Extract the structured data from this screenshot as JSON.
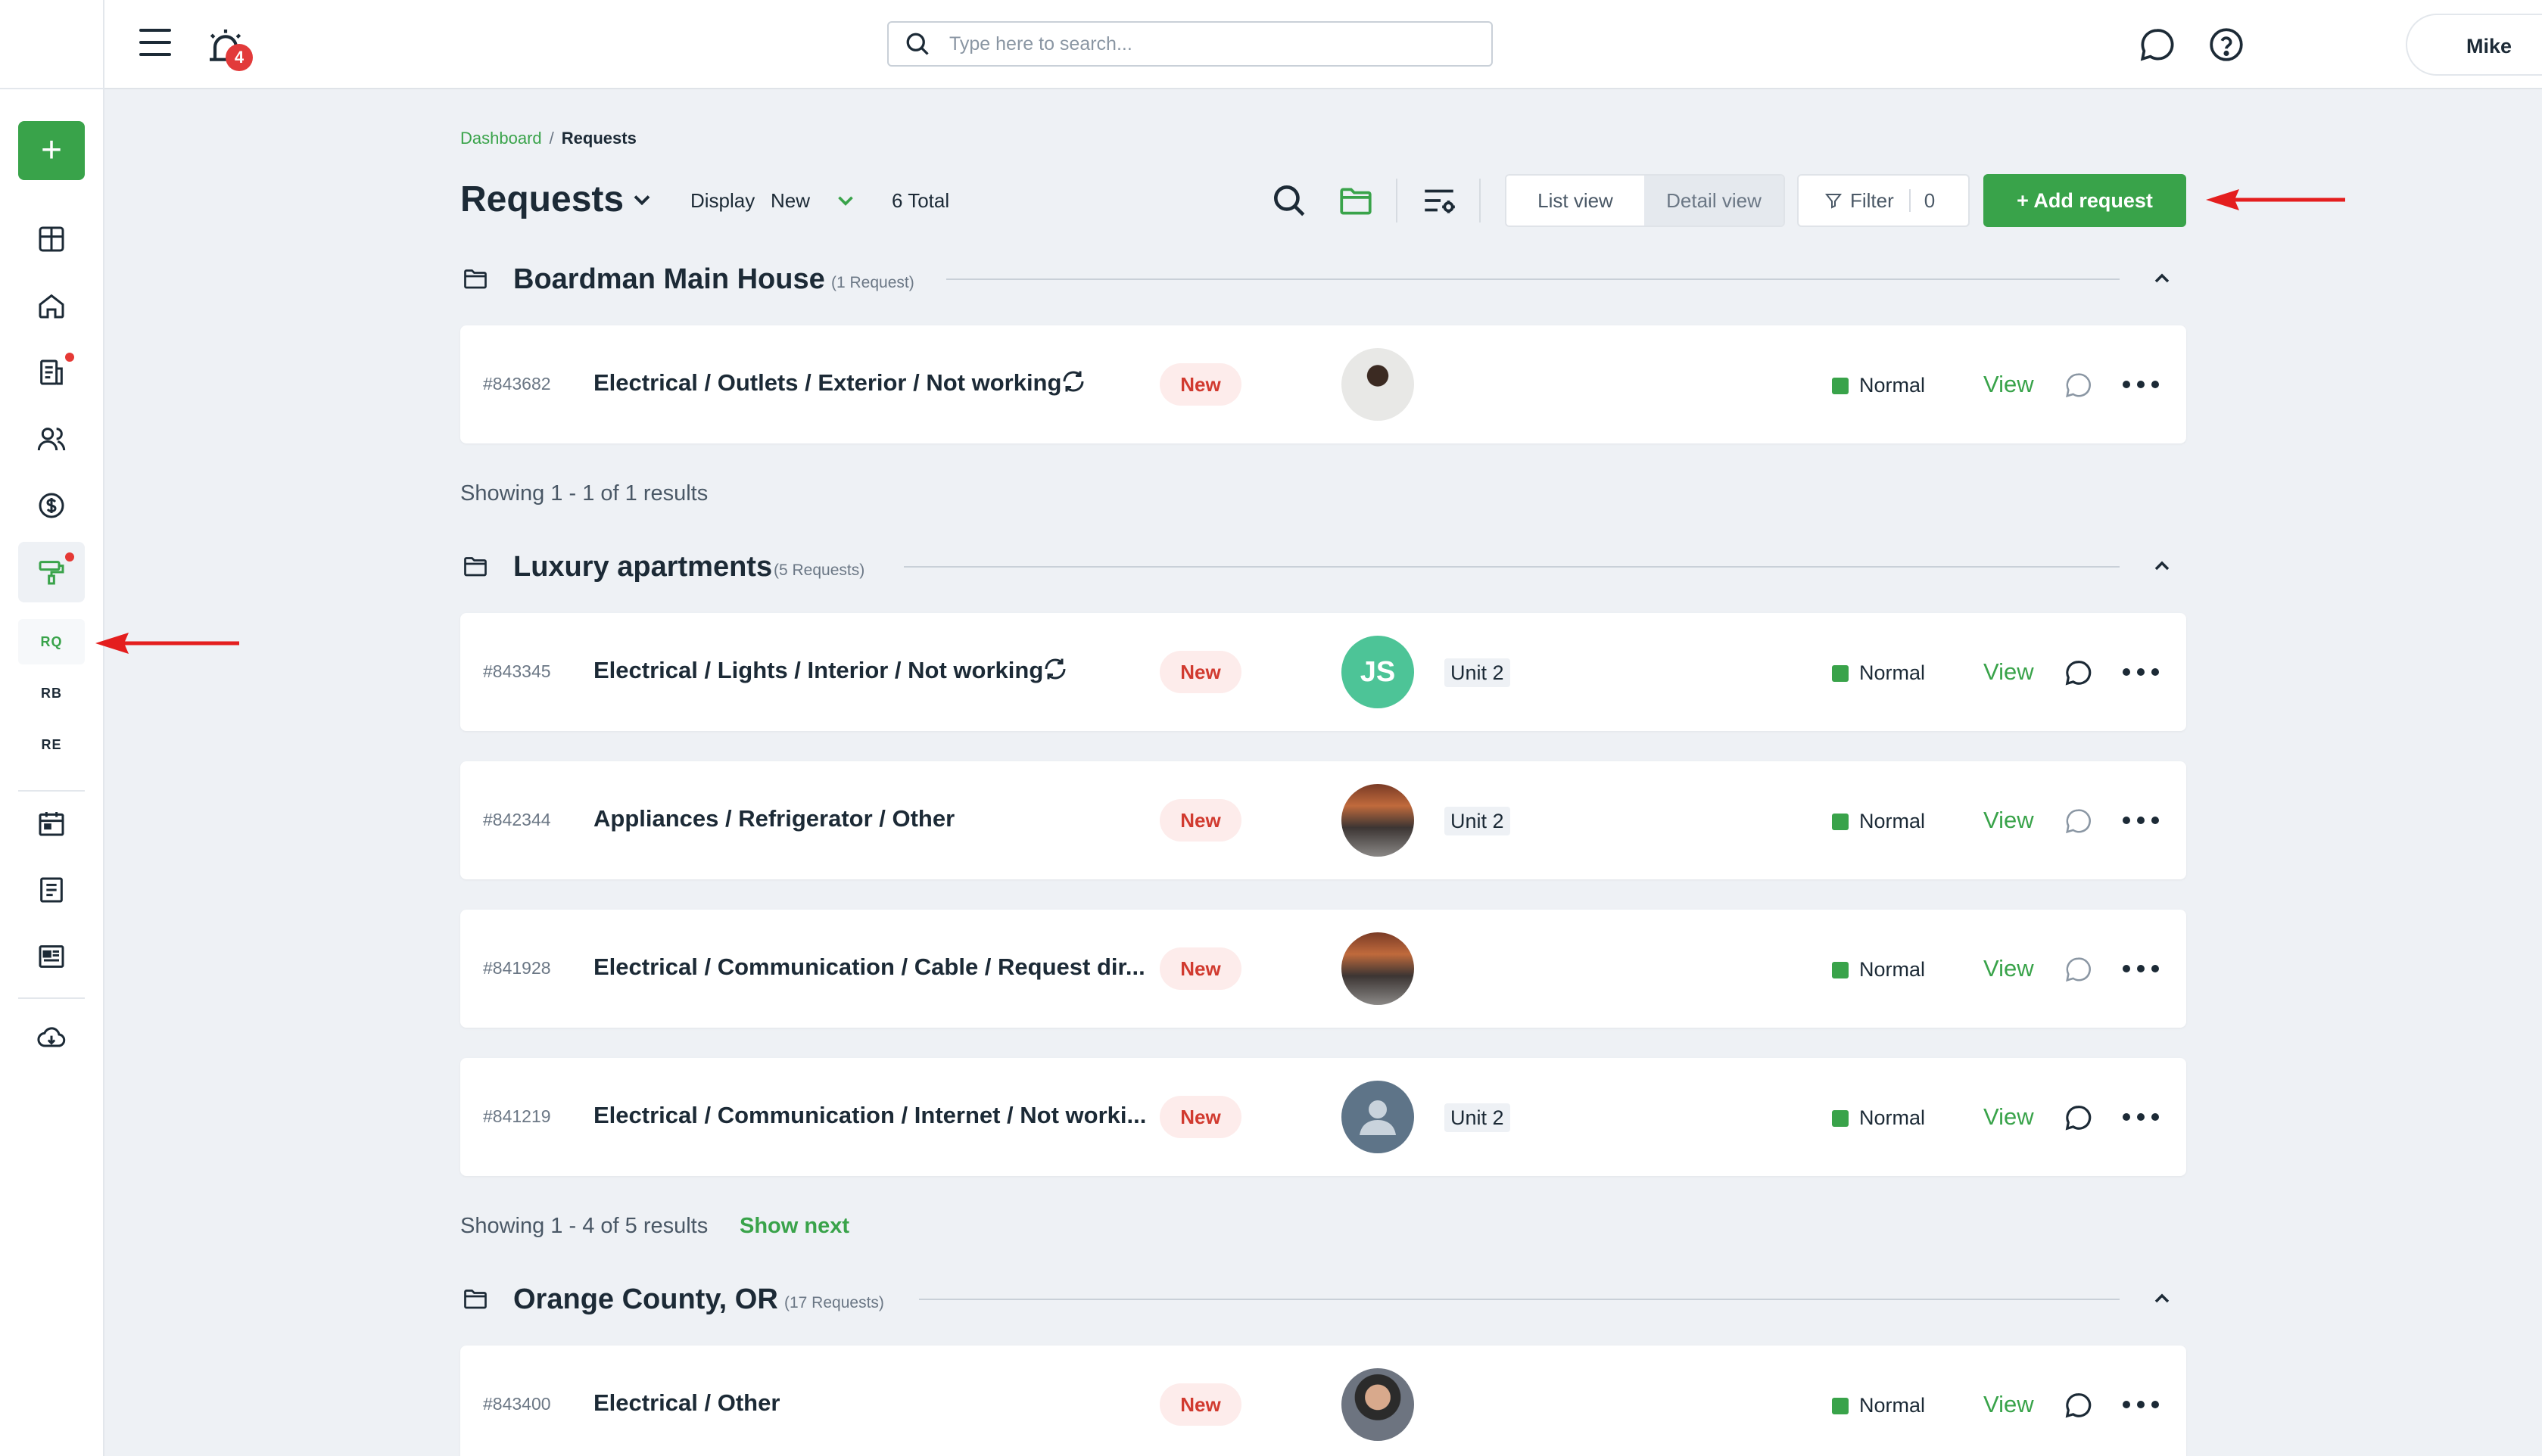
{
  "topbar": {
    "notification_count": "4",
    "search_placeholder": "Type here to search...",
    "user_name": "Mike"
  },
  "sidebar": {
    "add_label": "+",
    "sub_items": [
      "RQ",
      "RB",
      "RE"
    ]
  },
  "breadcrumb": {
    "root": "Dashboard",
    "separator": "/",
    "current": "Requests"
  },
  "header": {
    "title": "Requests",
    "display_label": "Display",
    "display_value": "New",
    "total": "6 Total",
    "list_view": "List view",
    "detail_view": "Detail view",
    "filter_label": "Filter",
    "filter_count": "0",
    "add_request": "+ Add request"
  },
  "groups": [
    {
      "name": "Boardman Main House",
      "count": "(1 Request)",
      "requests": [
        {
          "id": "#843682",
          "title": "Electrical / Outlets / Exterior / Not working",
          "status": "New",
          "unit": "",
          "priority": "Normal",
          "action": "View"
        }
      ],
      "showing": "Showing 1 - 1 of 1 results"
    },
    {
      "name": "Luxury apartments",
      "count": "(5 Requests)",
      "requests": [
        {
          "id": "#843345",
          "title": "Electrical / Lights / Interior / Not working",
          "status": "New",
          "avatar_initials": "JS",
          "unit": "Unit 2",
          "priority": "Normal",
          "action": "View"
        },
        {
          "id": "#842344",
          "title": "Appliances / Refrigerator / Other",
          "status": "New",
          "unit": "Unit 2",
          "priority": "Normal",
          "action": "View"
        },
        {
          "id": "#841928",
          "title": "Electrical / Communication / Cable / Request dir...",
          "status": "New",
          "unit": "",
          "priority": "Normal",
          "action": "View"
        },
        {
          "id": "#841219",
          "title": "Electrical / Communication / Internet / Not worki...",
          "status": "New",
          "unit": "Unit 2",
          "priority": "Normal",
          "action": "View"
        }
      ],
      "showing": "Showing 1 - 4 of 5 results",
      "show_next": "Show next"
    },
    {
      "name": "Orange County, OR",
      "count": "(17 Requests)",
      "requests": [
        {
          "id": "#843400",
          "title": "Electrical / Other",
          "status": "New",
          "unit": "",
          "priority": "Normal",
          "action": "View"
        }
      ]
    }
  ],
  "colors": {
    "brand_green": "#39a34a",
    "status_new_bg": "#fdeceb",
    "status_new_text": "#d13a2f",
    "annotation_arrow": "#e41e1e"
  }
}
